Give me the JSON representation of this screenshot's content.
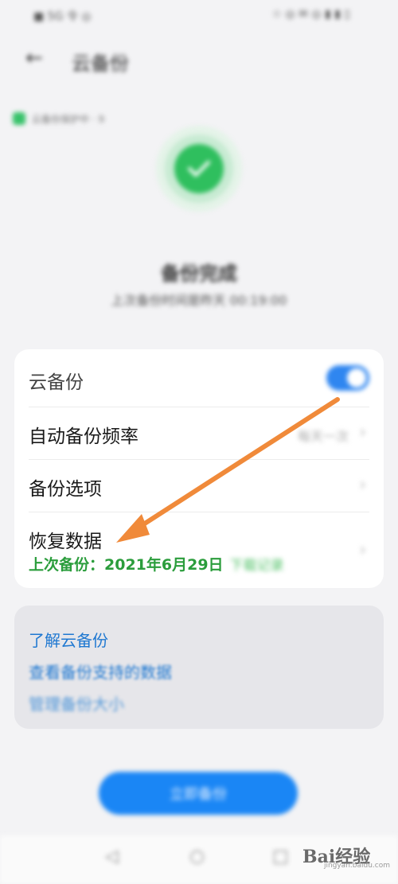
{
  "status_bar": {
    "left": "■ 5G 令 ◎",
    "right": "☆ ◎ ✉ ◎ ▮ ▮ ▯"
  },
  "header": {
    "title": "云备份"
  },
  "protect_chip": {
    "label": "云备份保护中 · 9"
  },
  "status": {
    "title": "备份完成",
    "subtitle": "上次备份时间是昨天 00:19:00"
  },
  "settings": {
    "cloud_backup": {
      "label": "云备份",
      "enabled": true
    },
    "auto_frequency": {
      "label": "自动备份频率",
      "value": "每天一次"
    },
    "backup_options": {
      "label": "备份选项"
    },
    "restore": {
      "label": "恢复数据",
      "last_backup": "上次备份：2021年6月29日",
      "link": "下载记录"
    }
  },
  "info": {
    "items": [
      "了解云备份",
      "查看备份支持的数据",
      "管理备份大小"
    ]
  },
  "primary_button": {
    "label": "立即备份"
  },
  "watermark": {
    "brand": "Bai经验",
    "site": "jingyan.baidu.com"
  },
  "colors": {
    "accent_blue": "#1a86f5",
    "toggle_blue": "#2f86f0",
    "success_green": "#2fbf5e",
    "text_green": "#2b9d3c",
    "arrow_orange": "#f08a3a",
    "link_blue": "#1f78d1"
  },
  "icons": {
    "back": "back-arrow-icon",
    "check": "check-icon",
    "chevron": "chevron-right-icon",
    "nav_back": "nav-back-icon",
    "nav_home": "nav-home-icon",
    "nav_recent": "nav-recent-icon"
  }
}
